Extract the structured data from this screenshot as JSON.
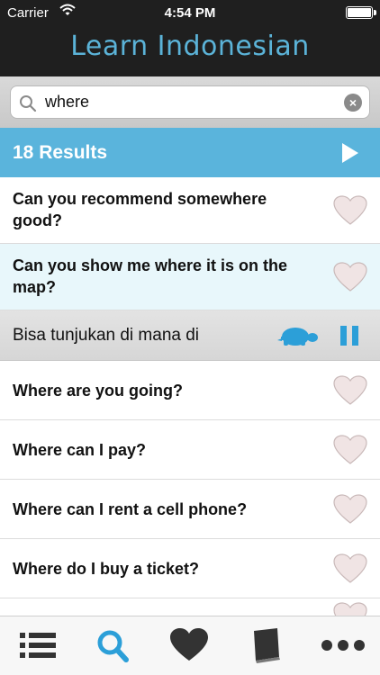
{
  "status_bar": {
    "carrier": "Carrier",
    "time": "4:54 PM",
    "icons": [
      "wifi-icon",
      "battery-icon"
    ]
  },
  "nav": {
    "title": "Learn Indonesian"
  },
  "search": {
    "value": "where",
    "icons": [
      "search-icon",
      "clear-icon"
    ]
  },
  "results": {
    "label": "18 Results",
    "icon": "play-icon"
  },
  "list": {
    "rows": [
      {
        "text": "Can you recommend somewhere good?"
      },
      {
        "text": "Can you show me where it is on the map?"
      },
      {
        "text": "Where are you going?"
      },
      {
        "text": "Where can I pay?"
      },
      {
        "text": "Where can I rent a cell phone?"
      },
      {
        "text": "Where do I buy a ticket?"
      }
    ],
    "expanded_translation": "Bisa tunjukan di mana di",
    "row_icon": "heart-icon",
    "translation_icons": [
      "turtle-slow-icon",
      "pause-icon"
    ]
  },
  "tab_bar": {
    "tabs": [
      "list-icon",
      "search-icon",
      "heart-icon",
      "book-icon",
      "more-icon"
    ],
    "active_tab": "search-icon"
  },
  "colors": {
    "accent": "#5ab4dc",
    "nav_background": "#1f1f1f",
    "title_text": "#5bb3d8",
    "selected_row": "#e8f7fb",
    "tab_active": "#2c9fd8",
    "tab_inactive": "#333333"
  }
}
